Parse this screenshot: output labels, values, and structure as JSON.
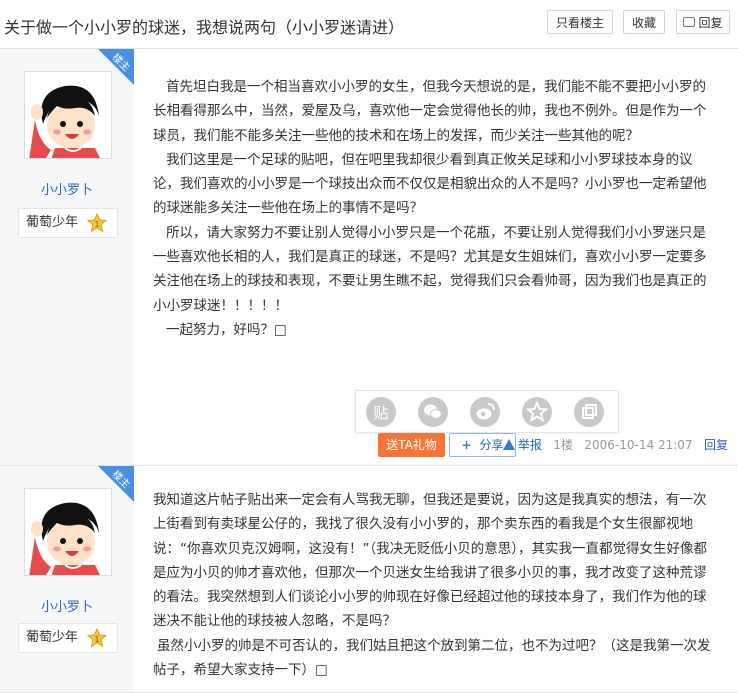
{
  "header": {
    "title": "关于做一个小小罗的球迷，我想说两句（小小罗迷请进）",
    "btn_only_op": "只看楼主",
    "btn_favorite": "收藏",
    "btn_reply": "回复"
  },
  "posts": [
    {
      "badge": "楼主",
      "username": "小小罗卜",
      "rank": "葡萄少年",
      "level": "1",
      "paragraphs": [
        "首先坦白我是一个相当喜欢小小罗的女生，但我今天想说的是，我们能不能不要把小小罗的长相看得那么中，当然，爱屋及乌，喜欢他一定会觉得他长的帅，我也不例外。但是作为一个球员，我们能不能多关注一些他的技术和在场上的发挥，而少关注一些其他的呢？",
        "我们这里是一个足球的贴吧，但在吧里我却很少看到真正攸关足球和小小罗球技本身的议论，我们喜欢的小小罗是一个球技出众而不仅仅是相貌出众的人不是吗？小小罗也一定希望他的球迷能多关注一些他在场上的事情不是吗？",
        "所以，请大家努力不要让别人觉得小小罗只是一个花瓶，不要让别人觉得我们小小罗迷只是一些喜欢他长相的人，我们是真正的球迷，不是吗？尤其是女生姐妹们，喜欢小小罗一定要多关注他在场上的球技和表现，不要让男生瞧不起，觉得我们只会看帅哥，因为我们也是真正的小小罗球迷！！！！！",
        "一起努力，好吗？□"
      ],
      "gift_label": "送TA礼物",
      "share_label": "分享",
      "report": "举报",
      "floor": "1楼",
      "time": "2006-10-14 21:07",
      "reply": "回复"
    },
    {
      "badge": "楼主",
      "username": "小小罗卜",
      "rank": "葡萄少年",
      "level": "1",
      "paragraphs": [
        "我知道这片帖子贴出来一定会有人骂我无聊，但我还是要说，因为这是我真实的想法，有一次上街看到有卖球星公仔的，我找了很久没有小小罗的，那个卖东西的看我是个女生很鄙视地说：“你喜欢贝克汉姆啊，这没有！”（我决无贬低小贝的意思），其实我一直都觉得女生好像都是应为小贝的帅才喜欢他，但那次一个贝迷女生给我讲了很多小贝的事，我才改变了这种荒谬的看法。我突然想到人们谈论小小罗的帅现在好像已经超过他的球技本身了，我们作为他的球迷决不能让他的球技被人忽略，不是吗？",
        "虽然小小罗的帅是不可否认的，我们姑且把这个放到第二位，也不为过吧？（这是我第一次发帖子，希望大家支持一下）□"
      ]
    }
  ],
  "colors": {
    "accent": "#2d64b3",
    "gift": "#f6763a",
    "badge": "#4a90e2"
  }
}
